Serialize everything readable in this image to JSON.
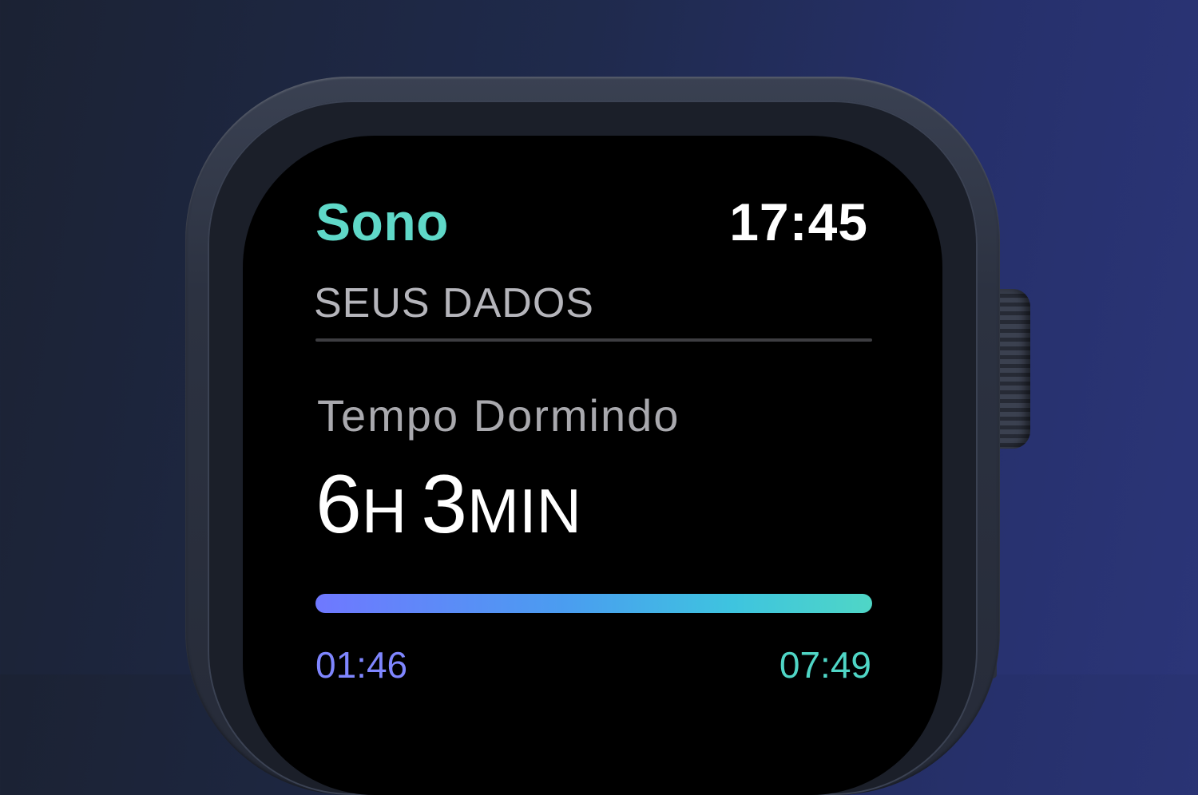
{
  "colors": {
    "accent": "#5fd8c8",
    "background": "#000000",
    "start_time": "#7f86ff",
    "end_time": "#4fd6c6"
  },
  "app": {
    "title": "Sono",
    "clock": "17:45"
  },
  "section": {
    "header": "SEUS DADOS"
  },
  "metric": {
    "label": "Tempo Dormindo",
    "hours_value": "6",
    "hours_unit": "H",
    "minutes_value": "3",
    "minutes_unit": "MIN"
  },
  "timeline": {
    "start": "01:46",
    "end": "07:49"
  }
}
